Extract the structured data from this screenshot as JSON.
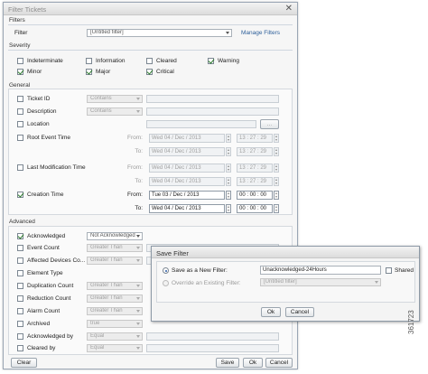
{
  "window": {
    "title": "Filter Tickets"
  },
  "filters": {
    "section": "Filters",
    "label": "Filter",
    "value": "[Untitled filter]",
    "manage_link": "Manage Filters"
  },
  "severity": {
    "section": "Severity",
    "items": [
      {
        "label": "Indeterminate",
        "checked": false
      },
      {
        "label": "Information",
        "checked": false
      },
      {
        "label": "Cleared",
        "checked": false
      },
      {
        "label": "Warning",
        "checked": true
      },
      {
        "label": "Minor",
        "checked": true
      },
      {
        "label": "Major",
        "checked": true
      },
      {
        "label": "Critical",
        "checked": true
      }
    ]
  },
  "general": {
    "section": "General",
    "ticket_id": {
      "label": "Ticket ID",
      "op": "Contains"
    },
    "description": {
      "label": "Description",
      "op": "Contains"
    },
    "location": {
      "label": "Location",
      "button": "..."
    },
    "root_event": {
      "label": "Root Event Time",
      "from_label": "From:",
      "from_date": "Wed 04 / Dec / 2013",
      "from_time": "13 : 27 : 29",
      "to_label": "To:",
      "to_date": "Wed 04 / Dec / 2013",
      "to_time": "13 : 27 : 29"
    },
    "last_mod": {
      "label": "Last Modification Time",
      "from_label": "From:",
      "from_date": "Wed 04 / Dec / 2013",
      "from_time": "13 : 27 : 29",
      "to_label": "To:",
      "to_date": "Wed 04 / Dec / 2013",
      "to_time": "13 : 27 : 29"
    },
    "creation": {
      "label": "Creation Time",
      "checked": true,
      "from_label": "From:",
      "from_date": "Tue 03 / Dec / 2013",
      "from_time": "00 : 00 : 00",
      "to_label": "To:",
      "to_date": "Wed 04 / Dec / 2013",
      "to_time": "00 : 00 : 00"
    }
  },
  "advanced": {
    "section": "Advanced",
    "rows": [
      {
        "label": "Acknowledged",
        "checked": true,
        "op": "Not Acknowledged",
        "enabled": true
      },
      {
        "label": "Event Count",
        "checked": false,
        "op": "Greater Than"
      },
      {
        "label": "Affected Devices Co...",
        "checked": false,
        "op": "Greater Than"
      },
      {
        "label": "Element Type",
        "checked": false,
        "op": ""
      },
      {
        "label": "Duplication Count",
        "checked": false,
        "op": "Greater Than"
      },
      {
        "label": "Reduction Count",
        "checked": false,
        "op": "Greater Than"
      },
      {
        "label": "Alarm Count",
        "checked": false,
        "op": "Greater Than"
      },
      {
        "label": "Archived",
        "checked": false,
        "op": "true"
      },
      {
        "label": "Acknowledged by",
        "checked": false,
        "op": "Equal"
      },
      {
        "label": "Cleared by",
        "checked": false,
        "op": "Equal"
      }
    ]
  },
  "footer": {
    "clear": "Clear",
    "save": "Save",
    "ok": "Ok",
    "cancel": "Cancel"
  },
  "save_dialog": {
    "title": "Save Filter",
    "new_label": "Save as a New Filter:",
    "new_value": "Unacknowledged-24Hours",
    "shared_label": "Shared",
    "override_label": "Override an Existing Filter:",
    "override_value": "[Untitled filter]",
    "ok": "Ok",
    "cancel": "Cancel"
  },
  "figure_number": "361723"
}
